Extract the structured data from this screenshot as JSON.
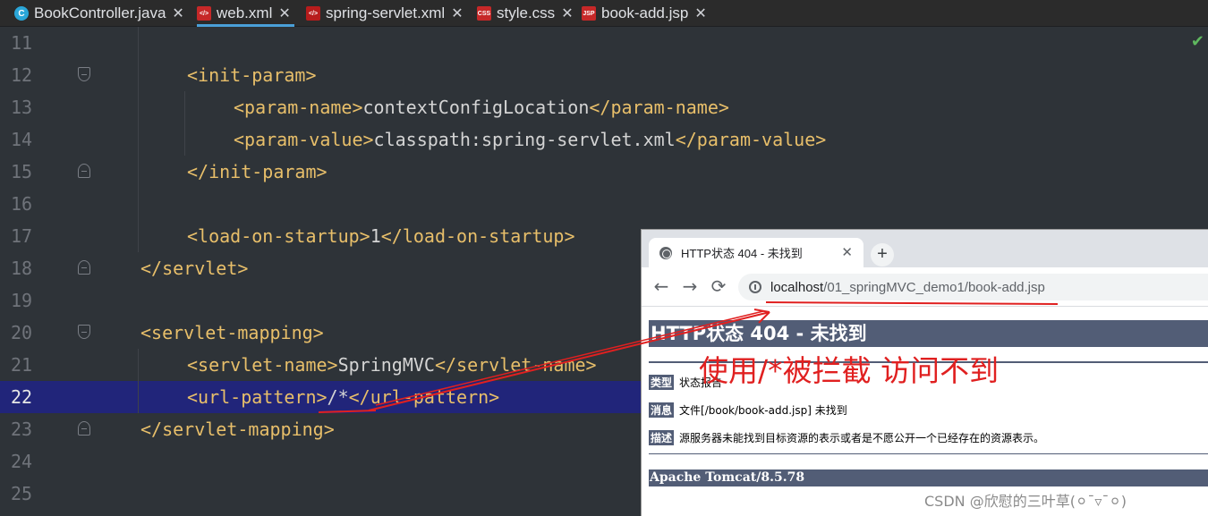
{
  "tabs": [
    {
      "label": "BookController.java",
      "icon": "java-class-icon",
      "icon_text": "C",
      "active": false
    },
    {
      "label": "web.xml",
      "icon": "xml-file-icon",
      "icon_text": "</>",
      "active": true
    },
    {
      "label": "spring-servlet.xml",
      "icon": "spring-config-icon",
      "icon_text": "</>",
      "active": false
    },
    {
      "label": "style.css",
      "icon": "css-file-icon",
      "icon_text": "CSS",
      "active": false
    },
    {
      "label": "book-add.jsp",
      "icon": "jsp-file-icon",
      "icon_text": "JSP",
      "active": false
    }
  ],
  "tab_close_glyph": "✕",
  "editor": {
    "current_line": "22",
    "status_check": "✔",
    "lines": [
      {
        "num": "11",
        "tag1": "",
        "text": "",
        "tag2": ""
      },
      {
        "num": "12",
        "tag1": "<init-param>",
        "text": "",
        "tag2": ""
      },
      {
        "num": "13",
        "tag1": "<param-name>",
        "text": "contextConfigLocation",
        "tag2": "</param-name>"
      },
      {
        "num": "14",
        "tag1": "<param-value>",
        "text": "classpath:spring-servlet.xml",
        "tag2": "</param-value>"
      },
      {
        "num": "15",
        "tag1": "</init-param>",
        "text": "",
        "tag2": ""
      },
      {
        "num": "16",
        "tag1": "",
        "text": "",
        "tag2": ""
      },
      {
        "num": "17",
        "tag1": "<load-on-startup>",
        "text": "1",
        "tag2": "</load-on-startup>"
      },
      {
        "num": "18",
        "tag1": "</servlet>",
        "text": "",
        "tag2": ""
      },
      {
        "num": "19",
        "tag1": "",
        "text": "",
        "tag2": ""
      },
      {
        "num": "20",
        "tag1": "<servlet-mapping>",
        "text": "",
        "tag2": ""
      },
      {
        "num": "21",
        "tag1": "<servlet-name>",
        "text": "SpringMVC",
        "tag2": "</servlet-name>"
      },
      {
        "num": "22",
        "tag1": "<url-pattern>",
        "text": "/*",
        "tag2": "</url-pattern>"
      },
      {
        "num": "23",
        "tag1": "</servlet-mapping>",
        "text": "",
        "tag2": ""
      },
      {
        "num": "24",
        "tag1": "",
        "text": "",
        "tag2": ""
      },
      {
        "num": "25",
        "tag1": "",
        "text": "",
        "tag2": ""
      }
    ]
  },
  "browser": {
    "tab_title": "HTTP状态 404 - 未找到",
    "tab_close": "✕",
    "new_tab": "+",
    "nav": {
      "back": "←",
      "forward": "→",
      "reload": "⟳"
    },
    "url_host": "localhost",
    "url_path": "/01_springMVC_demo1/book-add.jsp",
    "page": {
      "title": "HTTP状态 404 - 未找到",
      "rows": [
        {
          "label": "类型",
          "value": "状态报告"
        },
        {
          "label": "消息",
          "value": "文件[/book/book-add.jsp] 未找到"
        },
        {
          "label": "描述",
          "value": "源服务器未能找到目标资源的表示或者是不愿公开一个已经存在的资源表示。"
        }
      ],
      "footer": "Apache Tomcat/8.5.78"
    }
  },
  "annotation": {
    "text": "使用/*被拦截 访问不到",
    "color": "#e02020"
  },
  "watermark": "CSDN @欣慰的三叶草(⚪¯▿¯⚪)"
}
